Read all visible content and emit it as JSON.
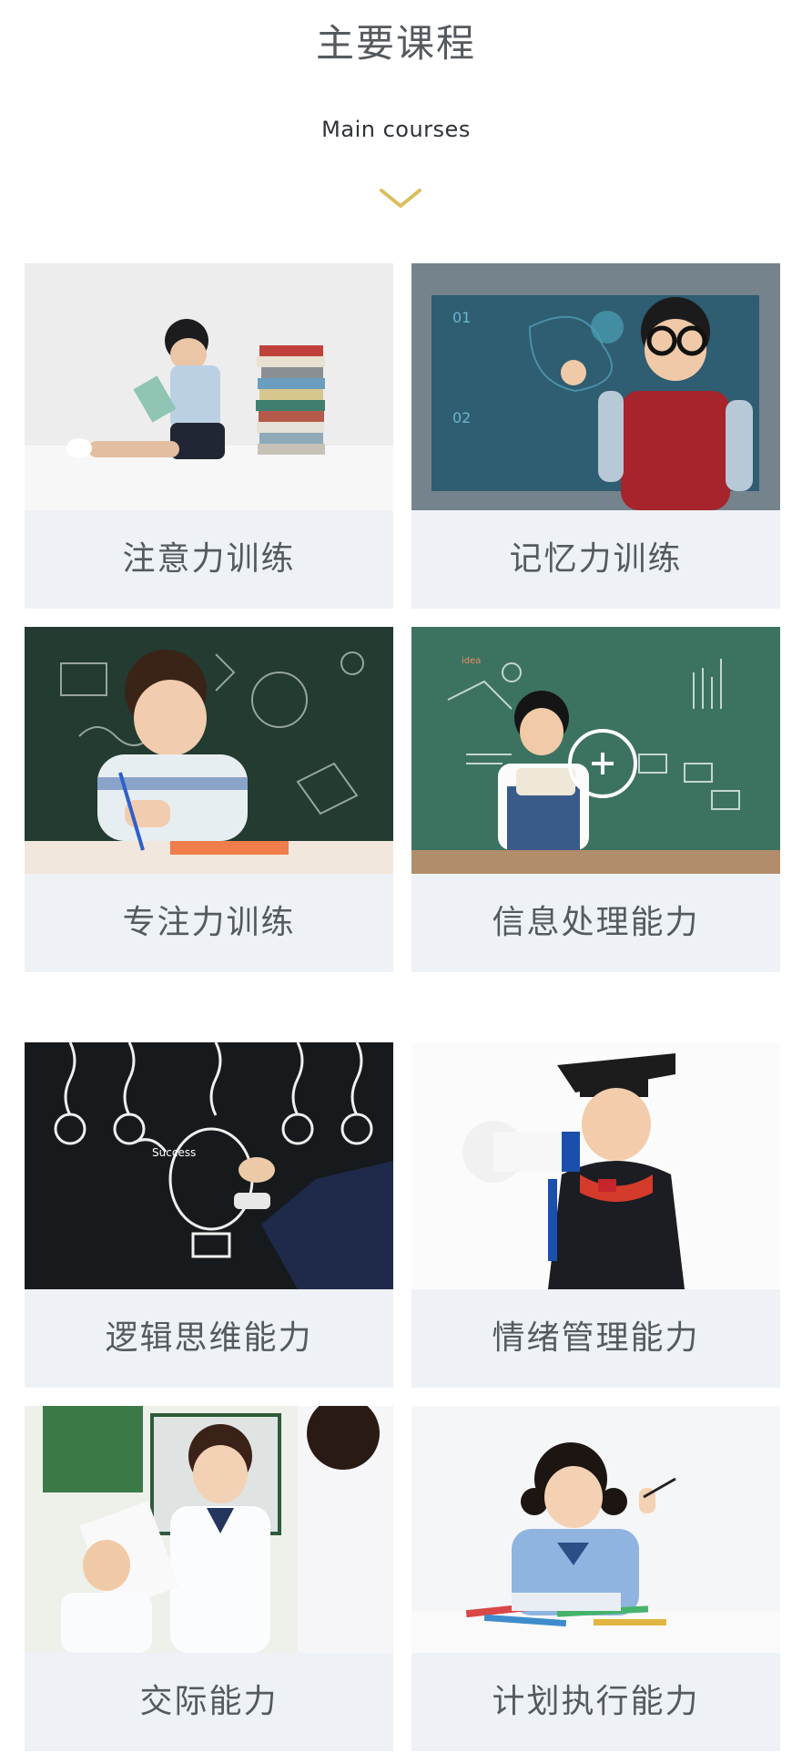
{
  "header": {
    "title": "主要课程",
    "subtitle": "Main courses"
  },
  "courses": [
    {
      "label": "注意力训练",
      "image": "boy-reading-with-book-stack",
      "icons": [
        "plus-circle-icon"
      ]
    },
    {
      "label": "记忆力训练",
      "image": "boy-with-glasses-touching-screen"
    },
    {
      "label": "专注力训练",
      "image": "boy-writing-chalkboard"
    },
    {
      "label": "信息处理能力",
      "image": "girl-reading-chalkboard"
    },
    {
      "label": "逻辑思维能力",
      "image": "hand-drawing-lightbulbs"
    },
    {
      "label": "情绪管理能力",
      "image": "child-graduate-megaphone"
    },
    {
      "label": "交际能力",
      "image": "students-classroom"
    },
    {
      "label": "计划执行能力",
      "image": "girl-drawing-pencils"
    }
  ],
  "colors": {
    "heading": "#555a5f",
    "label_bg": "#eef2f6",
    "chevron": "#d9bf5c"
  }
}
